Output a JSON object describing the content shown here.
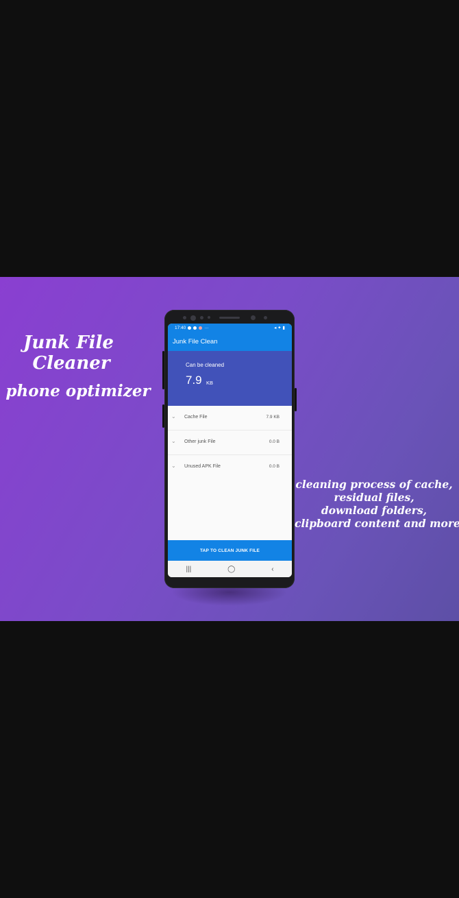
{
  "banner": {
    "headline_line1": "Junk File",
    "headline_line2": "Cleaner",
    "headline_line3": "phone optimizer",
    "side_lines": [
      "cleaning process of cache,",
      "residual files,",
      "download folders,",
      "clipboard content and more"
    ],
    "colors": {
      "gradient_start": "#8a3fd1",
      "gradient_end": "#5d4fa6"
    }
  },
  "phone": {
    "status": {
      "time": "17:40",
      "more": "···",
      "right_icons": "◂ ✦ ▮"
    },
    "app_title": "Junk File Clean",
    "summary": {
      "label": "Can be cleaned",
      "value": "7.9",
      "unit": "KB"
    },
    "items": [
      {
        "name": "Cache File",
        "size": "7.9 KB"
      },
      {
        "name": "Other junk File",
        "size": "0.0 B"
      },
      {
        "name": "Unused APK File",
        "size": "0.0 B"
      }
    ],
    "clean_button": "TAP TO CLEAN JUNK FILE",
    "nav": {
      "recents": "|||",
      "home": "◯",
      "back": "‹"
    },
    "colors": {
      "primary": "#1283e5",
      "summary_bg": "#4152b9"
    }
  }
}
